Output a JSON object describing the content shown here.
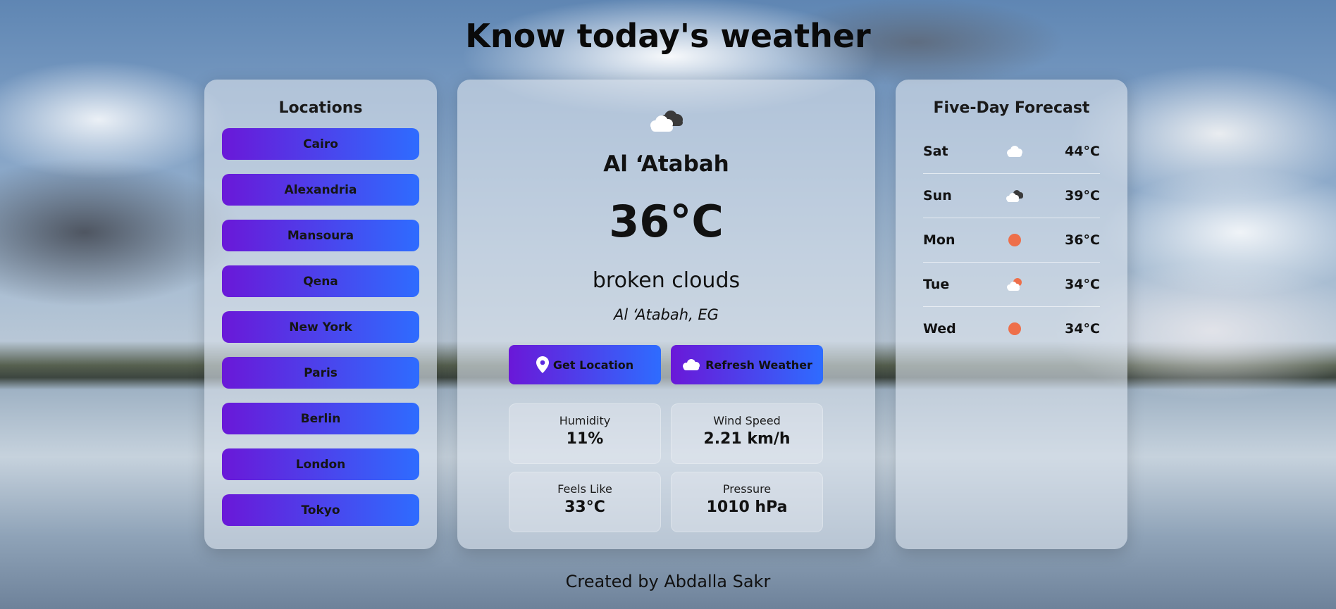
{
  "page_title": "Know today's weather",
  "locations": {
    "title": "Locations",
    "items": [
      "Cairo",
      "Alexandria",
      "Mansoura",
      "Qena",
      "New York",
      "Paris",
      "Berlin",
      "London",
      "Tokyo"
    ]
  },
  "current": {
    "icon": "broken-clouds-icon",
    "city": "Al ‘Atabah",
    "temperature": "36°C",
    "description": "broken clouds",
    "location": "Al ‘Atabah, EG",
    "get_location_label": "Get Location",
    "refresh_label": "Refresh Weather",
    "stats": {
      "humidity_label": "Humidity",
      "humidity_value": "11%",
      "wind_label": "Wind Speed",
      "wind_value": "2.21 km/h",
      "feels_label": "Feels Like",
      "feels_value": "33°C",
      "pressure_label": "Pressure",
      "pressure_value": "1010 hPa"
    }
  },
  "forecast": {
    "title": "Five-Day Forecast",
    "days": [
      {
        "day": "Sat",
        "icon": "cloud-icon",
        "temp": "44°C"
      },
      {
        "day": "Sun",
        "icon": "broken-clouds-icon",
        "temp": "39°C"
      },
      {
        "day": "Mon",
        "icon": "sun-icon",
        "temp": "36°C"
      },
      {
        "day": "Tue",
        "icon": "sun-behind-cloud-icon",
        "temp": "34°C"
      },
      {
        "day": "Wed",
        "icon": "sun-icon",
        "temp": "34°C"
      }
    ]
  },
  "footer": "Created by Abdalla Sakr",
  "colors": {
    "button_gradient_start": "#6a18d8",
    "button_gradient_end": "#2e6cff",
    "sun": "#ee6f4a"
  }
}
